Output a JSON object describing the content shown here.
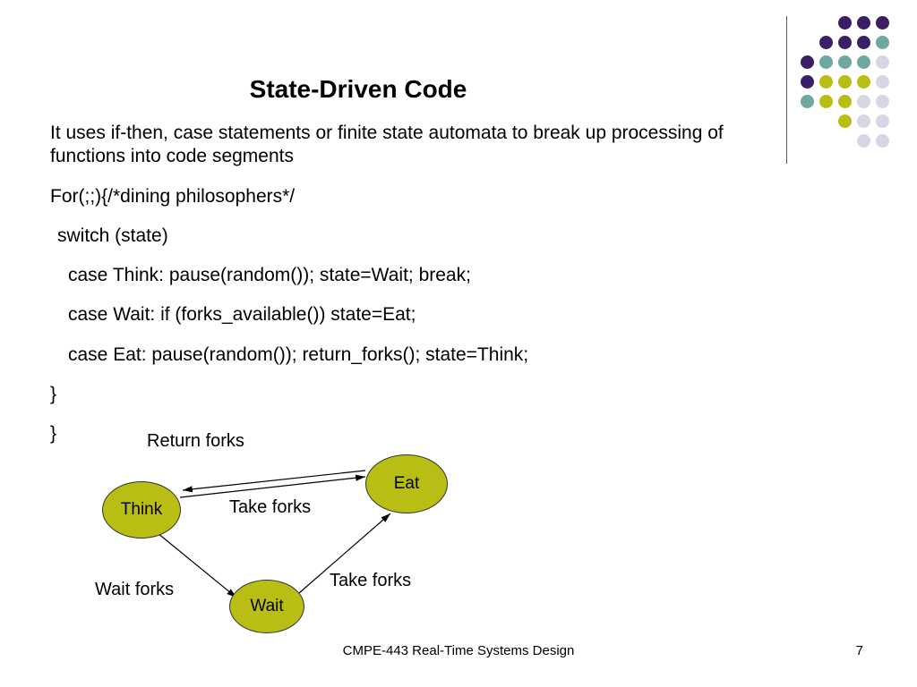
{
  "title": "State-Driven Code",
  "paragraphs": {
    "intro": "It uses if-then, case statements or finite state automata to break up processing of functions into code segments",
    "l1": "For(;;){/*dining philosophers*/",
    "l2": "switch (state)",
    "l3": "case Think: pause(random()); state=Wait; break;",
    "l4": "case Wait: if (forks_available()) state=Eat;",
    "l5": "case Eat: pause(random()); return_forks(); state=Think;",
    "l6": "}",
    "l7": "}"
  },
  "diagram": {
    "states": {
      "think": "Think",
      "eat": "Eat",
      "wait": "Wait"
    },
    "labels": {
      "return": "Return forks",
      "take_top": "Take forks",
      "wait_forks": "Wait forks",
      "take_bottom": "Take forks"
    }
  },
  "footer": {
    "center": "CMPE-443 Real-Time Systems Design",
    "page": "7"
  }
}
